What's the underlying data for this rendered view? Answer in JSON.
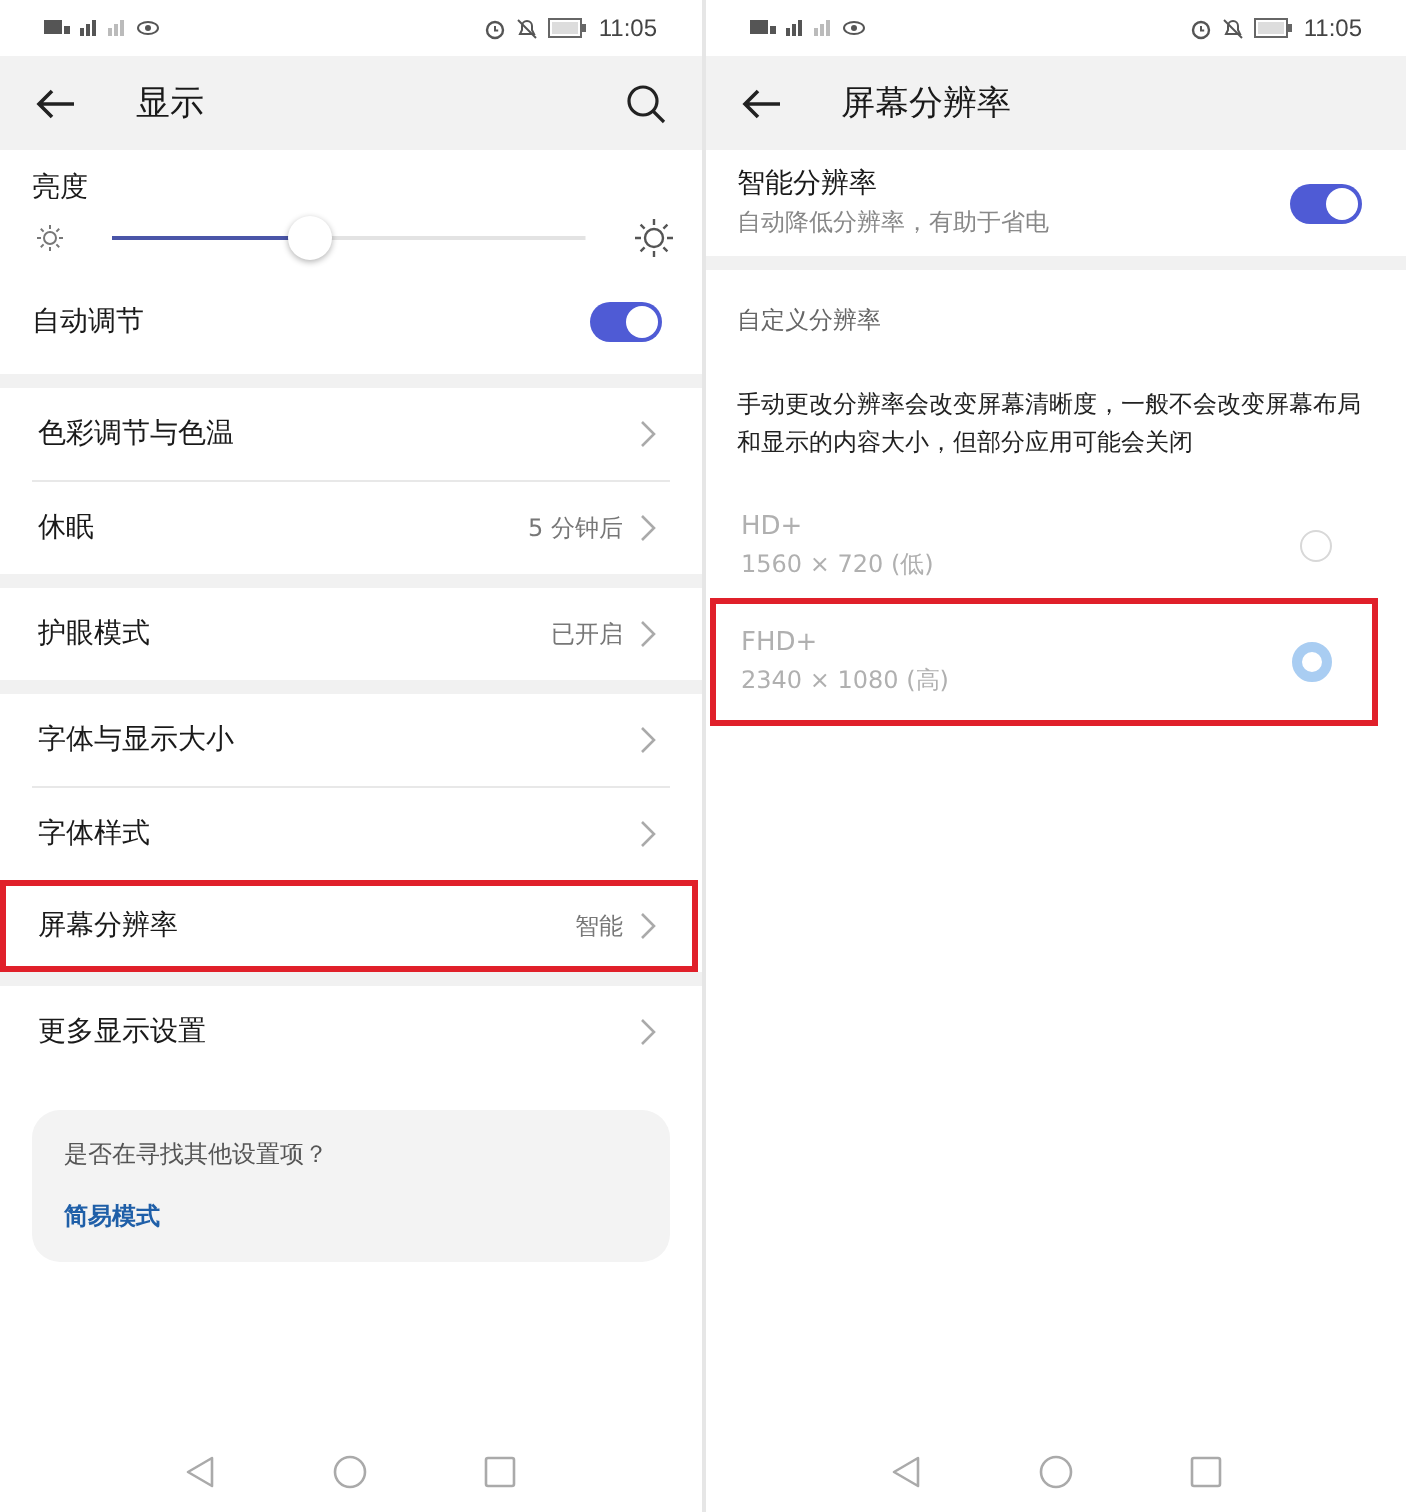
{
  "panels_status_time": [
    "11:05",
    "11:05"
  ],
  "left": {
    "title": "显示",
    "brightness": {
      "label": "亮度",
      "level": 0.42
    },
    "auto_adjust": {
      "label": "自动调节",
      "on": true
    },
    "groups": [
      [
        {
          "label": "色彩调节与色温",
          "highlighted": false
        },
        {
          "label": "休眠",
          "value": "5 分钟后",
          "highlighted": false
        }
      ],
      [
        {
          "label": "护眼模式",
          "value": "已开启",
          "highlighted": false
        }
      ],
      [
        {
          "label": "字体与显示大小",
          "highlighted": false
        },
        {
          "label": "字体样式",
          "highlighted": false
        },
        {
          "label": "屏幕分辨率",
          "value": "智能",
          "highlighted": true
        }
      ],
      [
        {
          "label": "更多显示设置",
          "highlighted": false
        }
      ]
    ],
    "card": {
      "question": "是否在寻找其他设置项？",
      "link": "简易模式"
    }
  },
  "right": {
    "title": "屏幕分辨率",
    "smart": {
      "label": "智能分辨率",
      "subtitle": "自动降低分辨率，有助于省电",
      "on": true
    },
    "section_label": "自定义分辨率",
    "description": "手动更改分辨率会改变屏幕清晰度，一般不会改变屏幕布局和显示的内容大小，但部分应用可能会关闭",
    "options": [
      {
        "name": "HD+",
        "detail": "1560 × 720 (低)",
        "selected": false,
        "disabled": true,
        "highlighted": false
      },
      {
        "name": "FHD+",
        "detail": "2340 × 1080 (高)",
        "selected": true,
        "disabled": true,
        "highlighted": true
      }
    ]
  }
}
